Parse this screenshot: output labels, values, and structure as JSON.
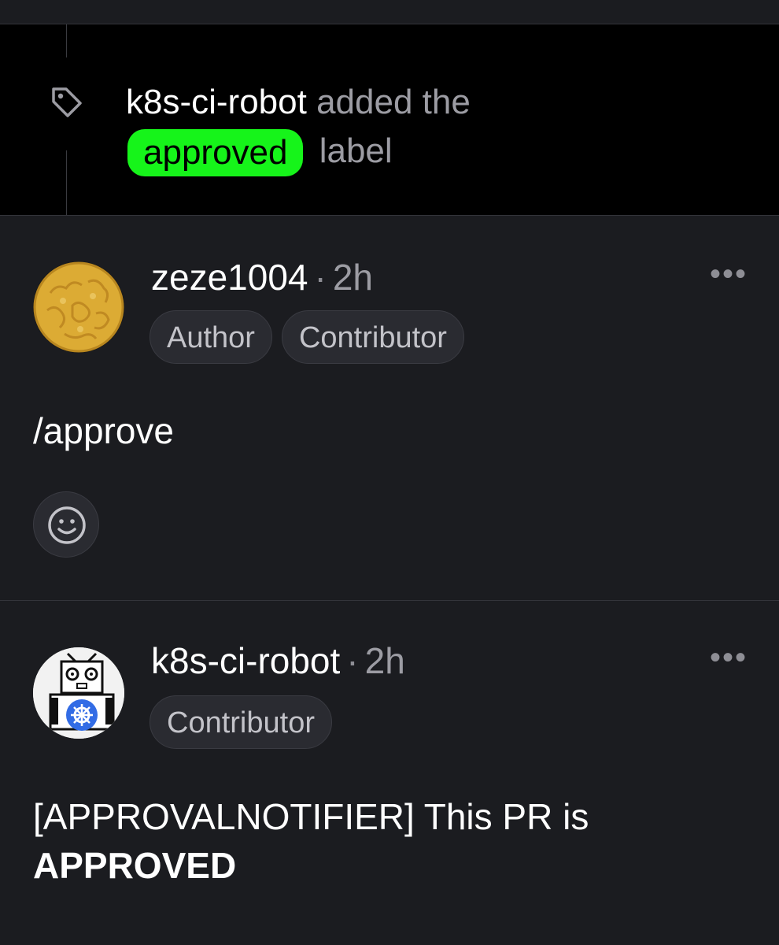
{
  "event": {
    "actor": "k8s-ci-robot",
    "action": "added the",
    "label": "approved",
    "suffix": "label",
    "icon": "tag-icon",
    "label_color": "#16f41a"
  },
  "comments": [
    {
      "author": "zeze1004",
      "separator": "·",
      "time": "2h",
      "badges": [
        "Author",
        "Contributor"
      ],
      "body": "/approve",
      "more_icon": "•••",
      "reaction_icon": "smiley-icon"
    },
    {
      "author": "k8s-ci-robot",
      "separator": "·",
      "time": "2h",
      "badges": [
        "Contributor"
      ],
      "body_line1": "[APPROVALNOTIFIER] This PR is",
      "body_line2": "APPROVED",
      "more_icon": "•••"
    }
  ]
}
